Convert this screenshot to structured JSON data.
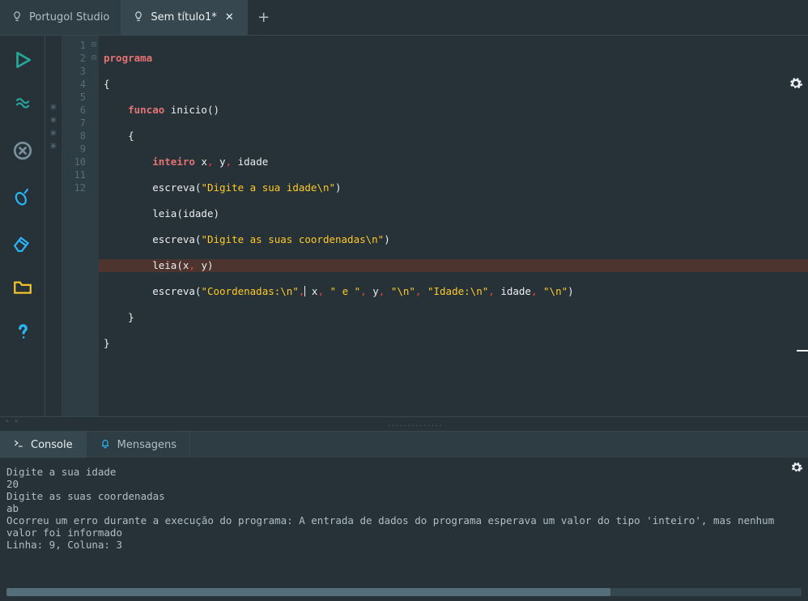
{
  "tabs": {
    "home_label": "Portugol Studio",
    "file_label": "Sem título1*"
  },
  "toolbar": {
    "run": "run-button",
    "debug": "debug-button",
    "stop": "stop-button",
    "clean": "clean-button",
    "eraser": "eraser-button",
    "open": "open-file-button",
    "help": "help-button"
  },
  "code": {
    "lines": [
      {
        "n": "1",
        "fold": "⊟"
      },
      {
        "n": "2",
        "fold": ""
      },
      {
        "n": "3",
        "fold": "⊟"
      },
      {
        "n": "4",
        "fold": ""
      },
      {
        "n": "5",
        "fold": ""
      },
      {
        "n": "6",
        "fold": ""
      },
      {
        "n": "7",
        "fold": ""
      },
      {
        "n": "8",
        "fold": ""
      },
      {
        "n": "9",
        "fold": ""
      },
      {
        "n": "10",
        "fold": ""
      },
      {
        "n": "11",
        "fold": ""
      },
      {
        "n": "12",
        "fold": ""
      }
    ],
    "kw_programa": "programa",
    "kw_funcao": "funcao",
    "kw_inteiro": "inteiro",
    "ident_inicio": "inicio",
    "var_x": "x",
    "var_y": "y",
    "var_idade": "idade",
    "fn_escreva": "escreva",
    "fn_leia": "leia",
    "str_digite_idade": "\"Digite a sua idade\\n\"",
    "str_digite_coord": "\"Digite as suas coordenadas\\n\"",
    "str_coord": "\"Coordenadas:\\n\"",
    "str_e": "\" e \"",
    "str_nl": "\"\\n\"",
    "str_idade": "\"Idade:\\n\"",
    "brace_open": "{",
    "brace_close": "}",
    "paren_open": "(",
    "paren_close": ")",
    "comma": ","
  },
  "bottom": {
    "tab_console": "Console",
    "tab_messages": "Mensagens"
  },
  "console": {
    "l1": "Digite a sua idade",
    "l2": "20",
    "l3": "Digite as suas coordenadas",
    "l4": "ab",
    "l5": "",
    "l6": "Ocorreu um erro durante a execução do programa: A entrada de dados do programa esperava um valor do tipo 'inteiro', mas nenhum valor foi informado",
    "l7": "Linha: 9, Coluna: 3"
  }
}
